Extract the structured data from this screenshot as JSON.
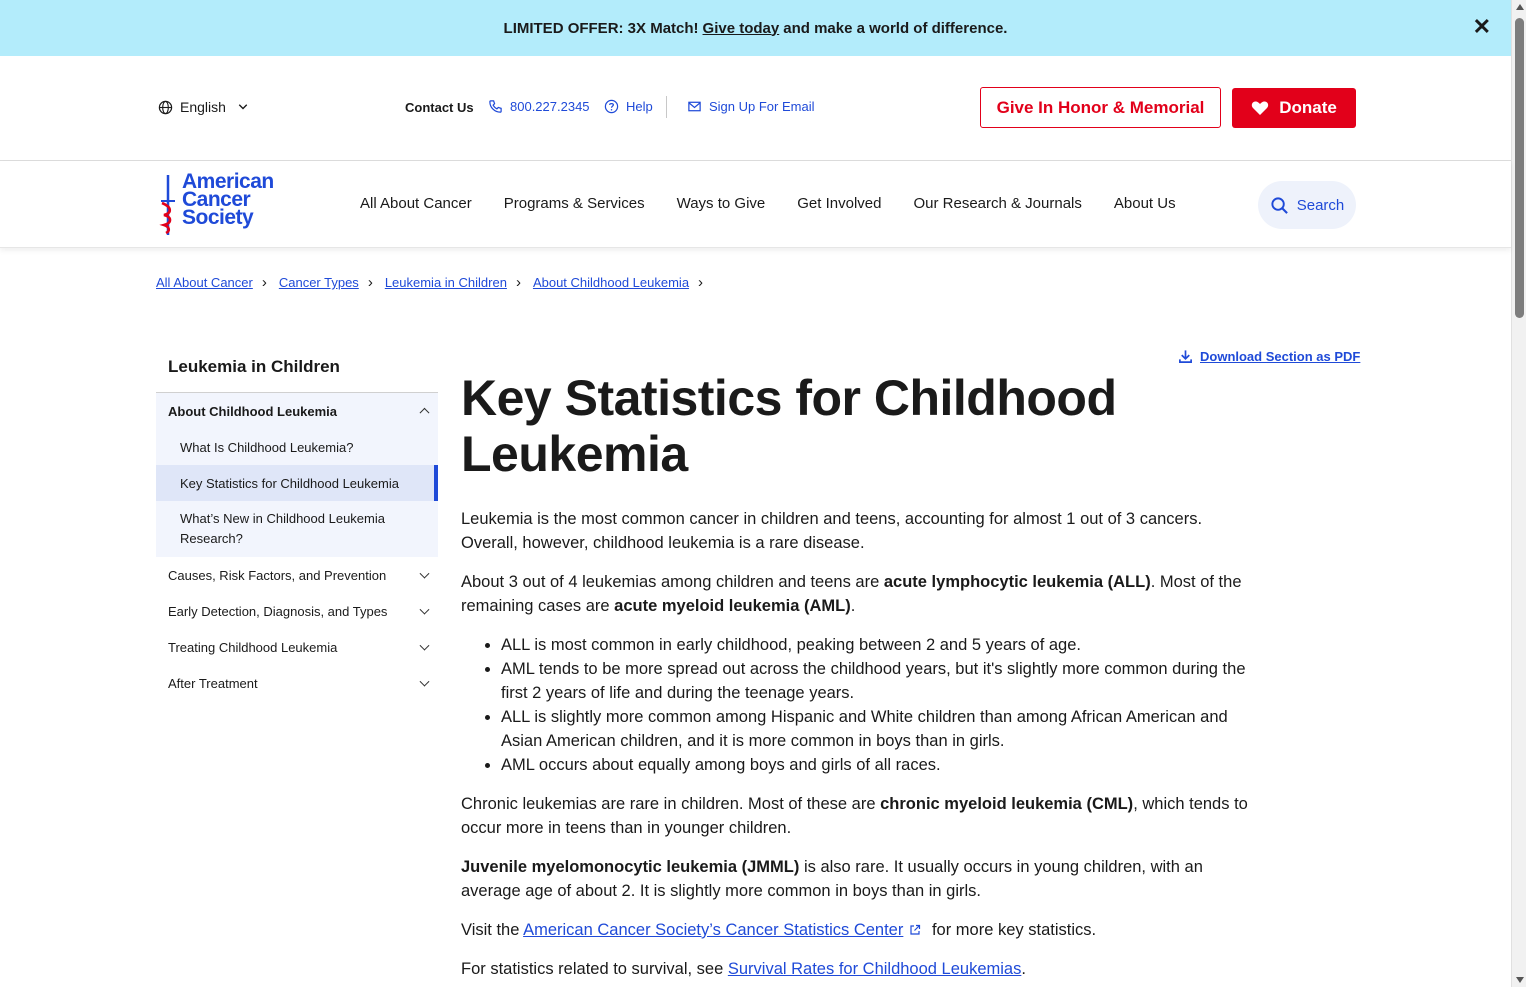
{
  "promo": {
    "prefix": "LIMITED OFFER: 3X Match!",
    "link": "Give today",
    "suffix": "and make a world of difference."
  },
  "utility": {
    "language": "English",
    "contact": "Contact Us",
    "phone": "800.227.2345",
    "help": "Help",
    "signup": "Sign Up For Email",
    "honor_button": "Give In Honor & Memorial",
    "donate_button": "Donate"
  },
  "brand": {
    "line1": "American",
    "line2": "Cancer",
    "line3": "Society",
    "color": "#1f4ad8",
    "red": "#e2001a"
  },
  "nav": {
    "items": [
      "All About Cancer",
      "Programs & Services",
      "Ways to Give",
      "Get Involved",
      "Our Research & Journals",
      "About Us"
    ],
    "search": "Search"
  },
  "breadcrumb": [
    "All About Cancer",
    "Cancer Types",
    "Leukemia in Children",
    "About Childhood Leukemia"
  ],
  "sidebar": {
    "title": "Leukemia in Children",
    "group_label": "About Childhood Leukemia",
    "sub_items": [
      "What Is Childhood Leukemia?",
      "Key Statistics for Childhood Leukemia",
      "What’s New in Childhood Leukemia Research?"
    ],
    "sections": [
      "Causes, Risk Factors, and Prevention",
      "Early Detection, Diagnosis, and Types",
      "Treating Childhood Leukemia",
      "After Treatment"
    ]
  },
  "content": {
    "pdf_link": "Download Section as PDF",
    "title": "Key Statistics for Childhood Leukemia",
    "p1": "Leukemia is the most common cancer in children and teens, accounting for almost 1 out of 3 cancers. Overall, however, childhood leukemia is a rare disease.",
    "p2_a": "About 3 out of 4 leukemias among children and teens are",
    "p2_b": "acute lymphocytic leukemia (ALL)",
    "p2_c": ". Most of the remaining cases are",
    "p2_d": "acute myeloid leukemia (AML)",
    "p2_e": ".",
    "bullets": [
      "ALL is most common in early childhood, peaking between 2 and 5 years of age.",
      "AML tends to be more spread out across the childhood years, but it's slightly more common during the first 2 years of life and during the teenage years.",
      "ALL is slightly more common among Hispanic and White children than among African American and Asian American children, and it is more common in boys than in girls.",
      "AML occurs about equally among boys and girls of all races."
    ],
    "p3_a": "Chronic leukemias are rare in children. Most of these are",
    "p3_b": "chronic myeloid leukemia (CML)",
    "p3_c": ", which tends to occur more in teens than in younger children.",
    "p4_a": "Juvenile myelomonocytic leukemia (JMML)",
    "p4_b": " is also rare. It usually occurs in young children, with an average age of about 2. It is slightly more common in boys than in girls.",
    "p5_a": "Visit the",
    "p5_link": "American Cancer Society’s Cancer Statistics Center",
    "p5_b": "for more key statistics.",
    "p6_a": "For statistics related to survival, see",
    "p6_link": "Survival Rates for Childhood Leukemias",
    "p6_b": "."
  }
}
